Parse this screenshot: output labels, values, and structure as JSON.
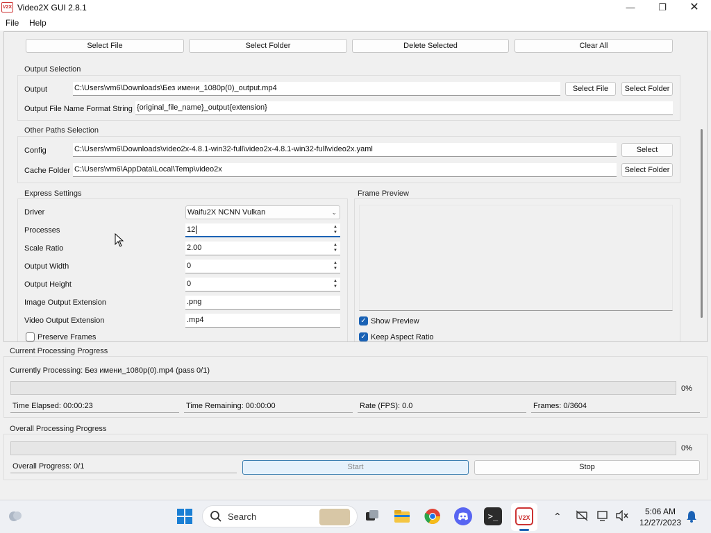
{
  "window": {
    "title": "Video2X GUI 2.8.1",
    "icon_text": "V2X"
  },
  "menu": [
    "File",
    "Help"
  ],
  "input_buttons": [
    "Select File",
    "Select Folder",
    "Delete Selected",
    "Clear All"
  ],
  "output_selection": {
    "title": "Output Selection",
    "output_label": "Output",
    "output_value": "C:\\Users\\vm6\\Downloads\\Без имени_1080p(0)_output.mp4",
    "select_file": "Select File",
    "select_folder": "Select Folder",
    "format_label": "Output File Name Format String",
    "format_value": "{original_file_name}_output{extension}"
  },
  "other_paths": {
    "title": "Other Paths Selection",
    "config_label": "Config",
    "config_value": "C:\\Users\\vm6\\Downloads\\video2x-4.8.1-win32-full\\video2x-4.8.1-win32-full\\video2x.yaml",
    "config_button": "Select",
    "cache_label": "Cache Folder",
    "cache_value": "C:\\Users\\vm6\\AppData\\Local\\Temp\\video2x",
    "cache_button": "Select Folder"
  },
  "express": {
    "title": "Express Settings",
    "driver_label": "Driver",
    "driver_value": "Waifu2X NCNN Vulkan",
    "processes_label": "Processes",
    "processes_value": "12",
    "scale_label": "Scale Ratio",
    "scale_value": "2.00",
    "width_label": "Output Width",
    "width_value": "0",
    "height_label": "Output Height",
    "height_value": "0",
    "img_ext_label": "Image Output Extension",
    "img_ext_value": ".png",
    "vid_ext_label": "Video Output Extension",
    "vid_ext_value": ".mp4",
    "preserve_label": "Preserve Frames",
    "preserve_checked": false
  },
  "preview": {
    "title": "Frame Preview",
    "show_label": "Show Preview",
    "show_checked": true,
    "aspect_label": "Keep Aspect Ratio",
    "aspect_checked": true
  },
  "current": {
    "title": "Current Processing Progress",
    "processing": "Currently Processing: Без имени_1080p(0).mp4 (pass 0/1)",
    "percent": "0%",
    "progress": 0,
    "elapsed": "Time Elapsed: 00:00:23",
    "remaining": "Time Remaining: 00:00:00",
    "rate": "Rate (FPS): 0.0",
    "frames": "Frames: 0/3604"
  },
  "overall": {
    "title": "Overall Processing Progress",
    "percent": "0%",
    "progress": 0,
    "count": "Overall Progress: 0/1",
    "start": "Start",
    "stop": "Stop"
  },
  "taskbar": {
    "search": "Search",
    "time": "5:06 AM",
    "date": "12/27/2023",
    "accent": "#1a62b5"
  }
}
